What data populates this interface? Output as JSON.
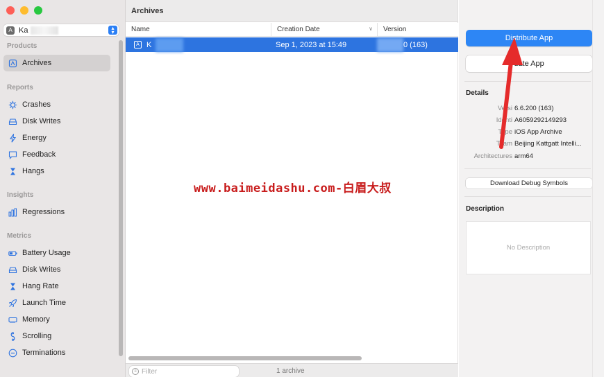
{
  "window": {
    "title": "Archives"
  },
  "scheme": {
    "app_label": "Ka",
    "icon": "app-icon"
  },
  "sidebar": {
    "sections": [
      {
        "title": "Products",
        "items": [
          {
            "label": "Archives",
            "icon": "archive-box-icon",
            "selected": true
          }
        ]
      },
      {
        "title": "Reports",
        "items": [
          {
            "label": "Crashes",
            "icon": "gear-icon"
          },
          {
            "label": "Disk Writes",
            "icon": "disk-icon"
          },
          {
            "label": "Energy",
            "icon": "bolt-icon"
          },
          {
            "label": "Feedback",
            "icon": "speech-bubble-icon"
          },
          {
            "label": "Hangs",
            "icon": "hourglass-icon"
          }
        ]
      },
      {
        "title": "Insights",
        "items": [
          {
            "label": "Regressions",
            "icon": "bar-chart-icon"
          }
        ]
      },
      {
        "title": "Metrics",
        "items": [
          {
            "label": "Battery Usage",
            "icon": "battery-icon"
          },
          {
            "label": "Disk Writes",
            "icon": "disk-icon"
          },
          {
            "label": "Hang Rate",
            "icon": "hourglass-icon"
          },
          {
            "label": "Launch Time",
            "icon": "rocket-icon"
          },
          {
            "label": "Memory",
            "icon": "memory-chip-icon"
          },
          {
            "label": "Scrolling",
            "icon": "scroll-icon"
          },
          {
            "label": "Terminations",
            "icon": "minus-circle-icon"
          }
        ]
      }
    ]
  },
  "table": {
    "columns": [
      "Name",
      "Creation Date",
      "Version"
    ],
    "rows": [
      {
        "name": "K",
        "date": "Sep 1, 2023 at 15:49",
        "version": "0 (163)"
      }
    ]
  },
  "watermark": "www.baimeidashu.com-白眉大叔",
  "footer": {
    "filter_placeholder": "Filter",
    "count": "1 archive"
  },
  "inspector": {
    "distribute_label": "Distribute App",
    "validate_label": "date App",
    "details_title": "Details",
    "details": [
      {
        "key": "Versi",
        "value": "6.6.200 (163)"
      },
      {
        "key": "Identi",
        "value": "A6059292149293"
      },
      {
        "key": "Type",
        "value": "iOS App Archive"
      },
      {
        "key": "Team",
        "value": "Beijing Kattgatt Intelli..."
      },
      {
        "key": "Architectures",
        "value": "arm64"
      }
    ],
    "debug_label": "Download Debug Symbols",
    "description_title": "Description",
    "description_placeholder": "No Description"
  },
  "colors": {
    "accent": "#2d74e0",
    "button_primary": "#2d86f5",
    "annotation_arrow": "#e52b2b",
    "watermark": "#c81c1c"
  }
}
